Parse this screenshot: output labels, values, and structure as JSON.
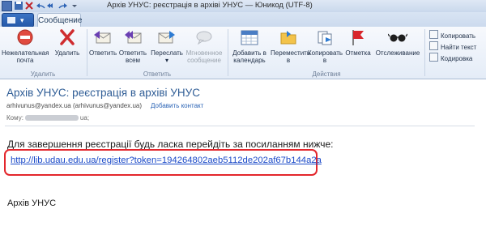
{
  "window": {
    "title": "Архів УНУС: реєстрація в архіві УНУС — Юникод (UTF-8)"
  },
  "tabs": {
    "active": "Сообщение"
  },
  "ribbon": {
    "groups": {
      "delete": {
        "label": "Удалить",
        "items": [
          {
            "label": "Нежелательная почта",
            "icon": "block-icon"
          },
          {
            "label": "Удалить",
            "icon": "delete-x-icon"
          }
        ]
      },
      "respond": {
        "label": "Ответить",
        "items": [
          {
            "label": "Ответить",
            "icon": "reply-icon"
          },
          {
            "label": "Ответить всем",
            "icon": "reply-all-icon"
          },
          {
            "label": "Переслать",
            "icon": "forward-icon"
          },
          {
            "label": "Мгновенное сообщение",
            "icon": "instant-message-icon",
            "disabled": true
          }
        ]
      },
      "actions": {
        "label": "Действия",
        "items": [
          {
            "label": "Добавить в календарь",
            "icon": "calendar-icon"
          },
          {
            "label": "Переместить в",
            "icon": "move-folder-icon"
          },
          {
            "label": "Копировать в",
            "icon": "copy-to-icon"
          },
          {
            "label": "Отметка",
            "icon": "flag-icon"
          },
          {
            "label": "Отслеживание",
            "icon": "glasses-icon"
          }
        ]
      },
      "clipboard": {
        "items": [
          {
            "label": "Копировать",
            "icon": "copy-icon"
          },
          {
            "label": "Найти текст",
            "icon": "find-icon"
          },
          {
            "label": "Кодировка",
            "icon": "encoding-icon"
          }
        ]
      }
    }
  },
  "message": {
    "subject": "Архів УНУС: реєстрація в архіві УНУС",
    "sender": "arhivunus@yandex.ua (arhivunus@yandex.ua)",
    "add_contact": "Добавить контакт",
    "to_label": "Кому:",
    "to_suffix": "ua;",
    "body_intro": "Для  завершення реєстрації будь ласка перейдіть за посиланням нижче:",
    "link": "http://lib.udau.edu.ua/register?token=194264802aeb5112de202af67b144a2a",
    "signature": "Архів УНУС"
  },
  "colors": {
    "accent_blue": "#2f5d96",
    "link": "#1a49c8",
    "highlight_box": "#e3262c"
  }
}
